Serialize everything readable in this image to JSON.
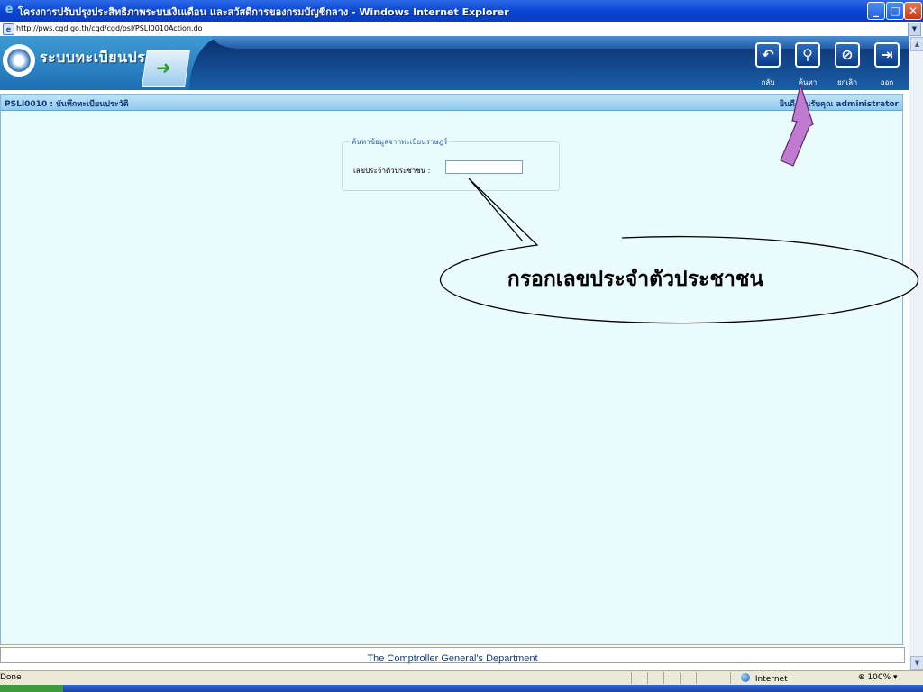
{
  "window": {
    "title": "โครงการปรับปรุงประสิทธิภาพระบบเงินเดือน และสวัสดิการของกรมบัญชีกลาง - Windows Internet Explorer",
    "minimize": "_",
    "maximize": "□",
    "close": "✕"
  },
  "address": {
    "url": "http://pws.cgd.go.th/cgd/cgd/psl/PSLI0010Action.do"
  },
  "app": {
    "title": "ระบบทะเบียนประวัติ"
  },
  "toolbar": [
    {
      "label": "กลับ",
      "icon": "back-arrow-icon",
      "glyph": "↶"
    },
    {
      "label": "ค้นหา",
      "icon": "search-icon",
      "glyph": "⚲"
    },
    {
      "label": "ยกเลิก",
      "icon": "cancel-icon",
      "glyph": "⊘"
    },
    {
      "label": "ออก",
      "icon": "exit-icon",
      "glyph": "⇥"
    }
  ],
  "page": {
    "code_title": "PSLI0010 : บันทึกทะเบียนประวัติ",
    "welcome": "ยินดีต้อนรับคุณ administrator"
  },
  "search": {
    "legend": "ค้นหาข้อมูลจากทะเบียนราษฎร์",
    "label": "เลขประจำตัวประชาชน :",
    "value": ""
  },
  "callout": {
    "text": "กรอกเลขประจำตัวประชาชน"
  },
  "footer": {
    "text": "The Comptroller General's Department"
  },
  "status": {
    "text": "Done",
    "zone": "Internet",
    "zoom": "100%"
  },
  "colors": {
    "header": "#1d6fb3",
    "page_bg": "#eafbfd",
    "arrow": "#c07ad0"
  }
}
